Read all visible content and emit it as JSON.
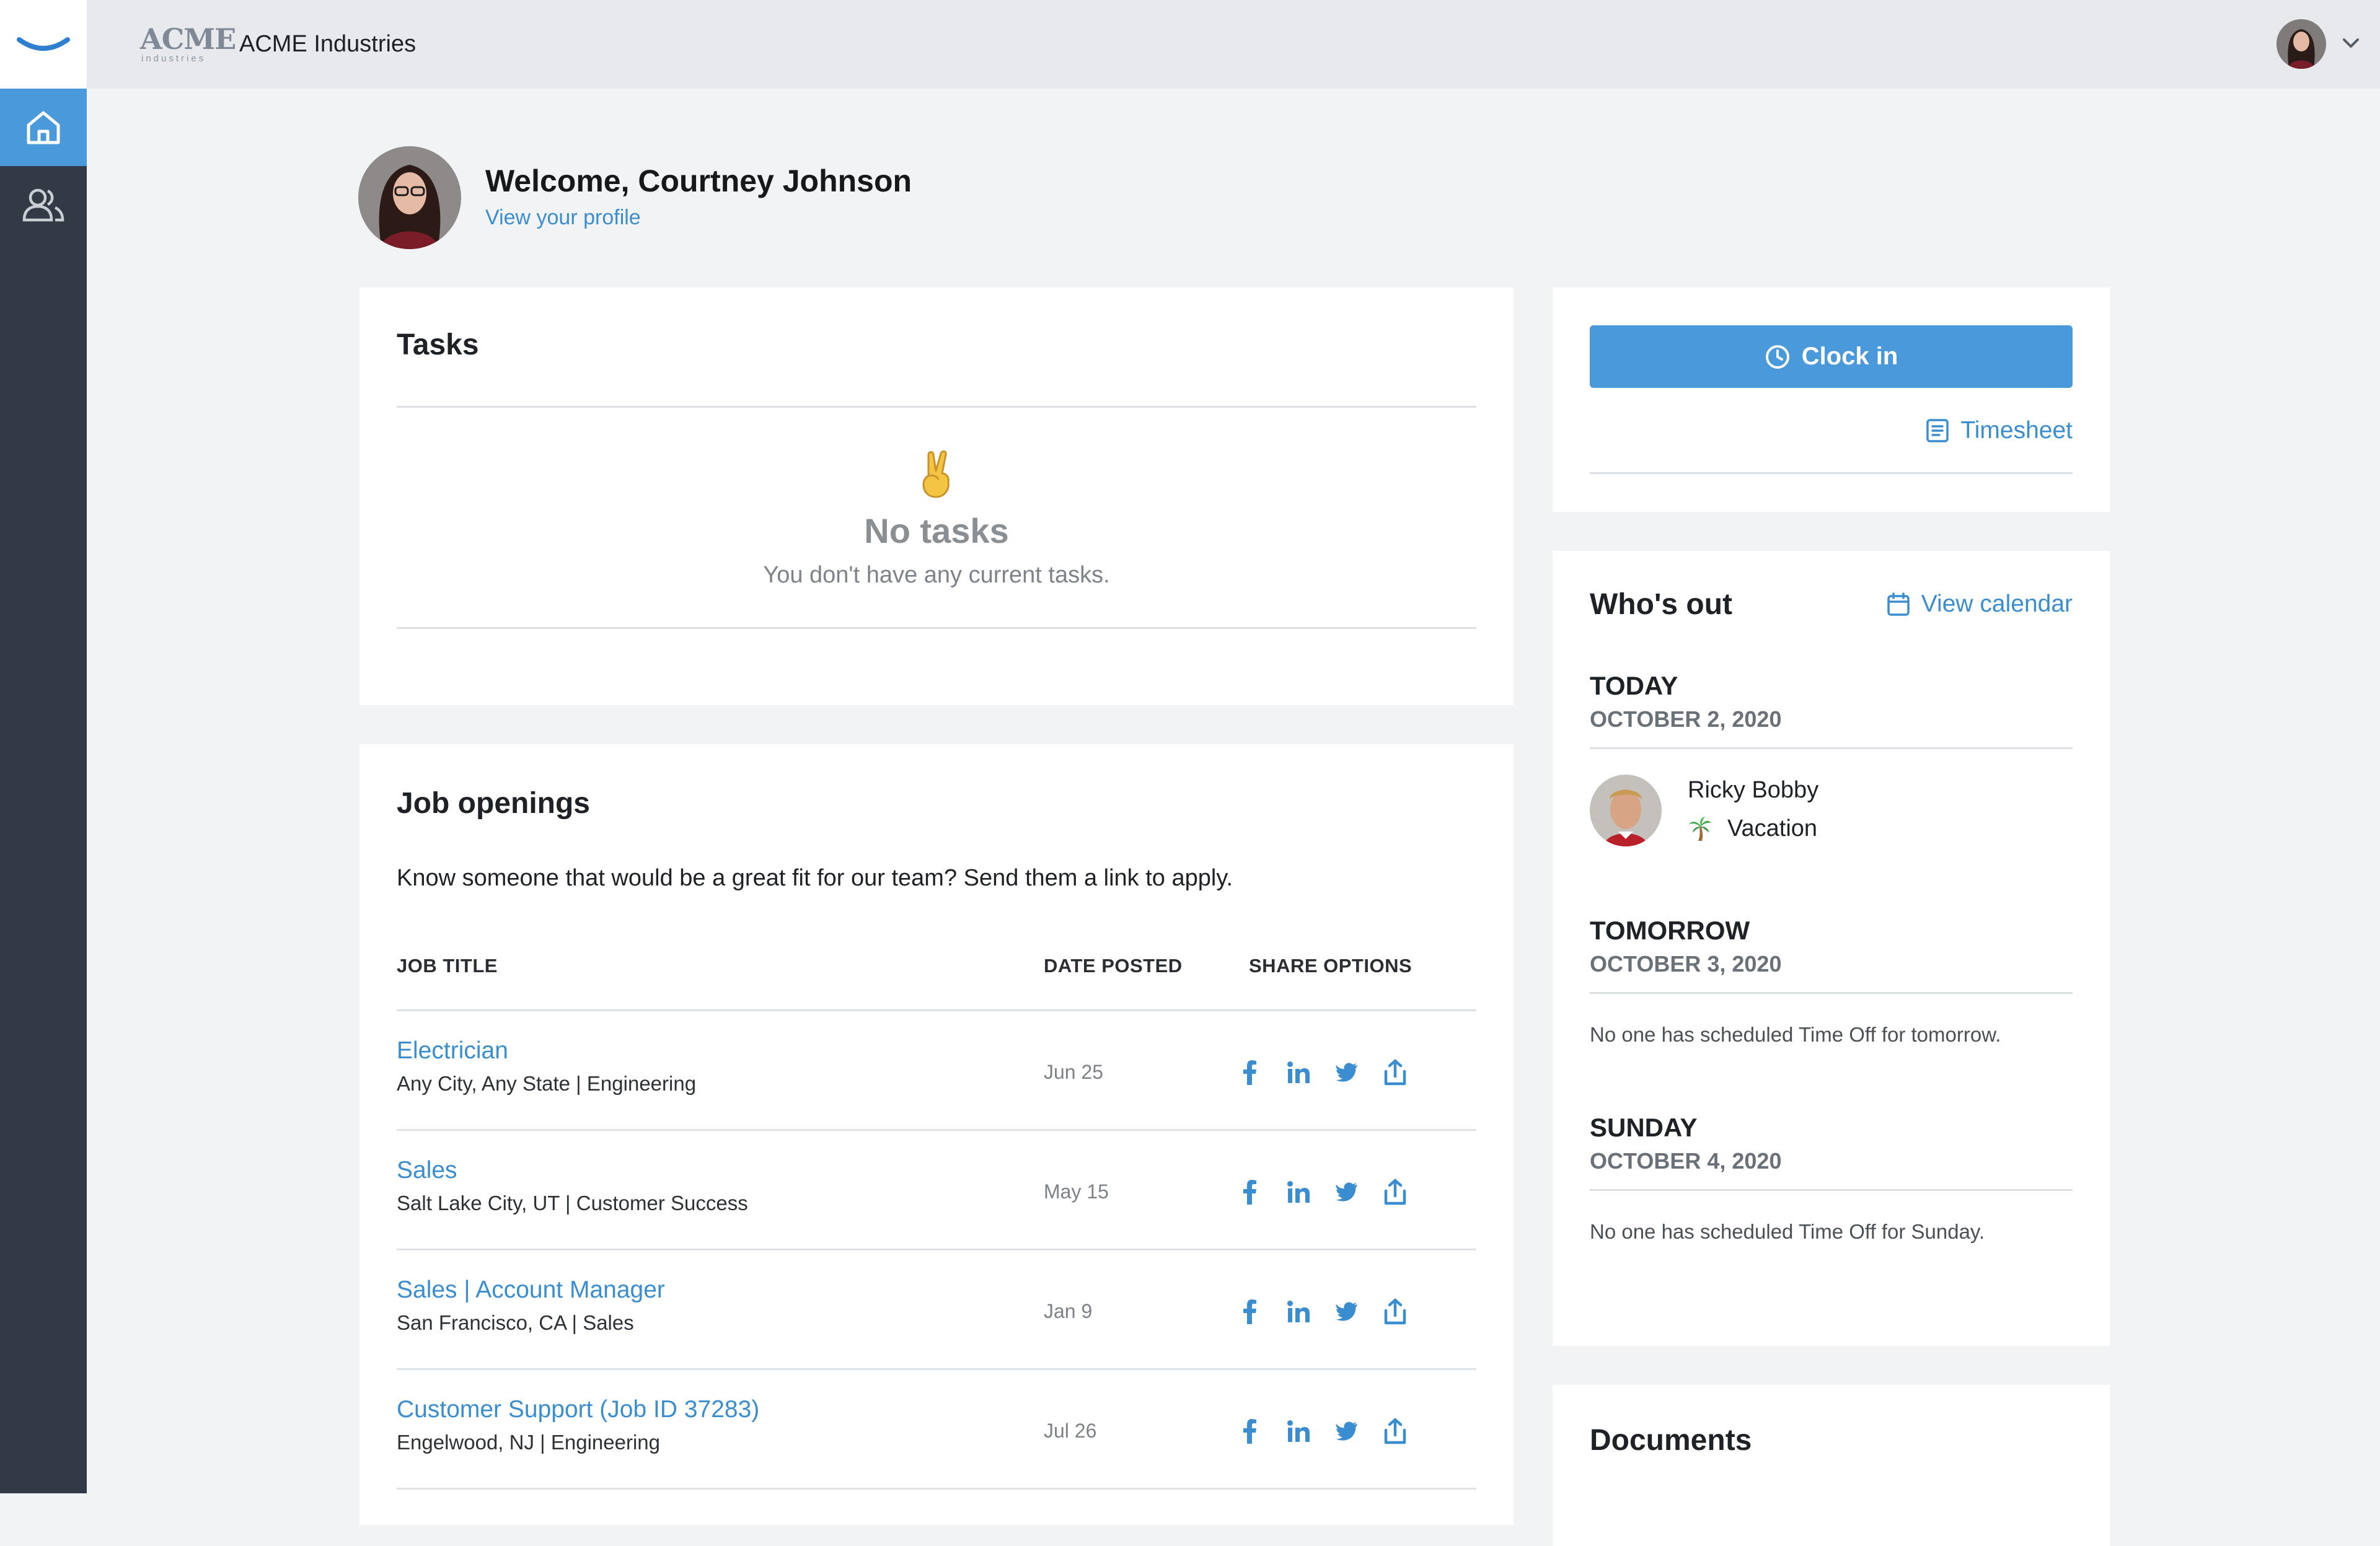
{
  "header": {
    "acme_logo_main": "ACME",
    "acme_logo_sub": "industries",
    "company_name": "ACME Industries"
  },
  "sidebar": {
    "items": [
      {
        "icon": "home-icon",
        "active": true
      },
      {
        "icon": "people-icon",
        "active": false
      }
    ]
  },
  "welcome": {
    "title": "Welcome, Courtney Johnson",
    "profile_link": "View your profile"
  },
  "tasks": {
    "title": "Tasks",
    "empty_title": "No tasks",
    "empty_subtitle": "You don't have any current tasks."
  },
  "jobs": {
    "title": "Job openings",
    "intro": "Know someone that would be a great fit for our team? Send them a link to apply.",
    "columns": [
      "JOB TITLE",
      "DATE POSTED",
      "SHARE OPTIONS"
    ],
    "rows": [
      {
        "title": "Electrician",
        "meta": "Any City, Any State | Engineering",
        "date": "Jun 25"
      },
      {
        "title": "Sales",
        "meta": "Salt Lake City, UT | Customer Success",
        "date": "May 15"
      },
      {
        "title": "Sales | Account Manager",
        "meta": "San Francisco, CA | Sales",
        "date": "Jan 9"
      },
      {
        "title": "Customer Support (Job ID 37283)",
        "meta": "Engelwood, NJ | Engineering",
        "date": "Jul 26"
      }
    ],
    "share_icons": [
      "facebook-icon",
      "linkedin-icon",
      "twitter-icon",
      "share-icon"
    ]
  },
  "clock": {
    "button_label": "Clock in",
    "timesheet_label": "Timesheet"
  },
  "whos_out": {
    "title": "Who's out",
    "calendar_link": "View calendar",
    "days": [
      {
        "label": "TODAY",
        "date": "OCTOBER 2, 2020"
      },
      {
        "label": "TOMORROW",
        "date": "OCTOBER 3, 2020",
        "message": "No one has scheduled Time Off for tomorrow."
      },
      {
        "label": "SUNDAY",
        "date": "OCTOBER 4, 2020",
        "message": "No one has scheduled Time Off for Sunday."
      }
    ],
    "person": {
      "name": "Ricky Bobby",
      "reason": "Vacation"
    }
  },
  "documents": {
    "title": "Documents"
  },
  "colors": {
    "accent": "#4a9adb",
    "link": "#3a8ed0",
    "sidebar": "#323a45",
    "topbar": "#e7e9ec",
    "background": "#f2f3f5"
  }
}
